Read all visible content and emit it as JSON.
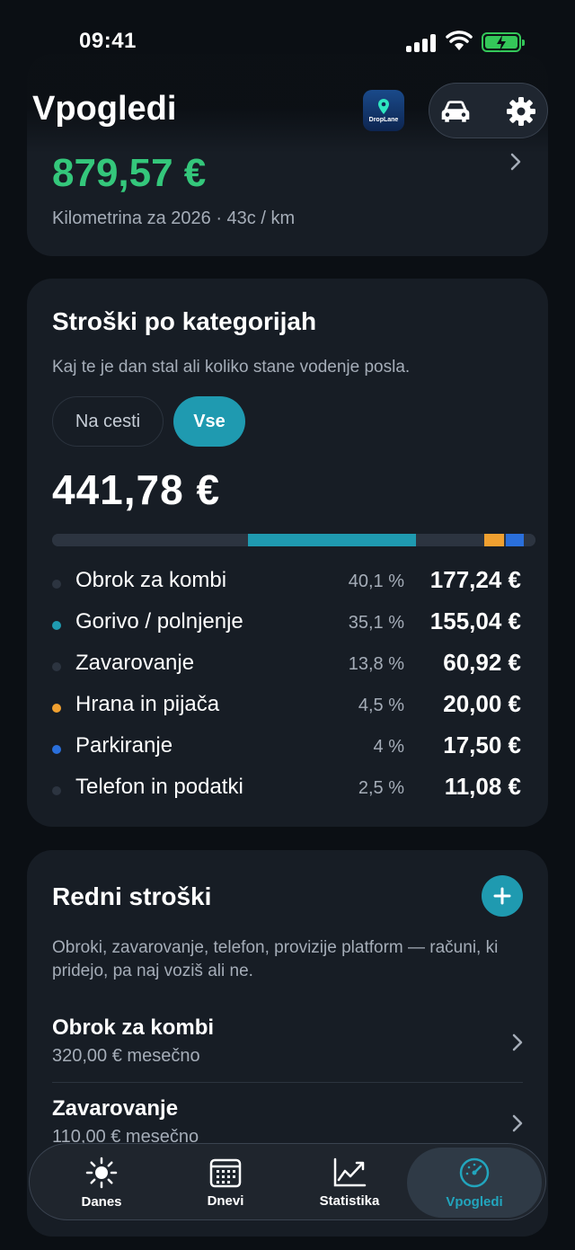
{
  "status_bar": {
    "time": "09:41"
  },
  "header": {
    "title": "Vpogledi",
    "logo_text": "DropLane"
  },
  "mileage_card": {
    "amount": "879,57 €",
    "subtitle": "Kilometrina za 2026 · 43c / km"
  },
  "categories_card": {
    "title": "Stroški po kategorijah",
    "description": "Kaj te je dan stal ali koliko stane vodenje posla.",
    "segments": [
      "Na cesti",
      "Vse"
    ],
    "selected_segment": "Vse",
    "total": "441,78 €",
    "rows": [
      {
        "name": "Obrok za kombi",
        "percent": "40,1 %",
        "value": "177,24 €",
        "color": "#2c3440"
      },
      {
        "name": "Gorivo / polnjenje",
        "percent": "35,1 %",
        "value": "155,04 €",
        "color": "#1f9ab0"
      },
      {
        "name": "Zavarovanje",
        "percent": "13,8 %",
        "value": "60,92 €",
        "color": "#2c3440"
      },
      {
        "name": "Hrana in pijača",
        "percent": "4,5 %",
        "value": "20,00 €",
        "color": "#f0a030"
      },
      {
        "name": "Parkiranje",
        "percent": "4 %",
        "value": "17,50 €",
        "color": "#2a6fdb"
      },
      {
        "name": "Telefon in podatki",
        "percent": "2,5 %",
        "value": "11,08 €",
        "color": "#2c3440"
      }
    ]
  },
  "recurring_card": {
    "title": "Redni stroški",
    "description": "Obroki, zavarovanje, telefon, provizije platform — računi, ki pridejo, pa naj voziš ali ne.",
    "items": [
      {
        "name": "Obrok za kombi",
        "sub": "320,00 € mesečno"
      },
      {
        "name": "Zavarovanje",
        "sub": "110,00 € mesečno"
      }
    ]
  },
  "tabs": [
    {
      "label": "Danes",
      "icon": "sun-icon"
    },
    {
      "label": "Dnevi",
      "icon": "calendar-icon"
    },
    {
      "label": "Statistika",
      "icon": "chart-line-icon"
    },
    {
      "label": "Vpogledi",
      "icon": "gauge-icon",
      "active": true
    }
  ],
  "colors": {
    "accent": "#1f9ab0",
    "positive": "#34c77b",
    "card": "#171d25",
    "background": "#0b0f14"
  }
}
